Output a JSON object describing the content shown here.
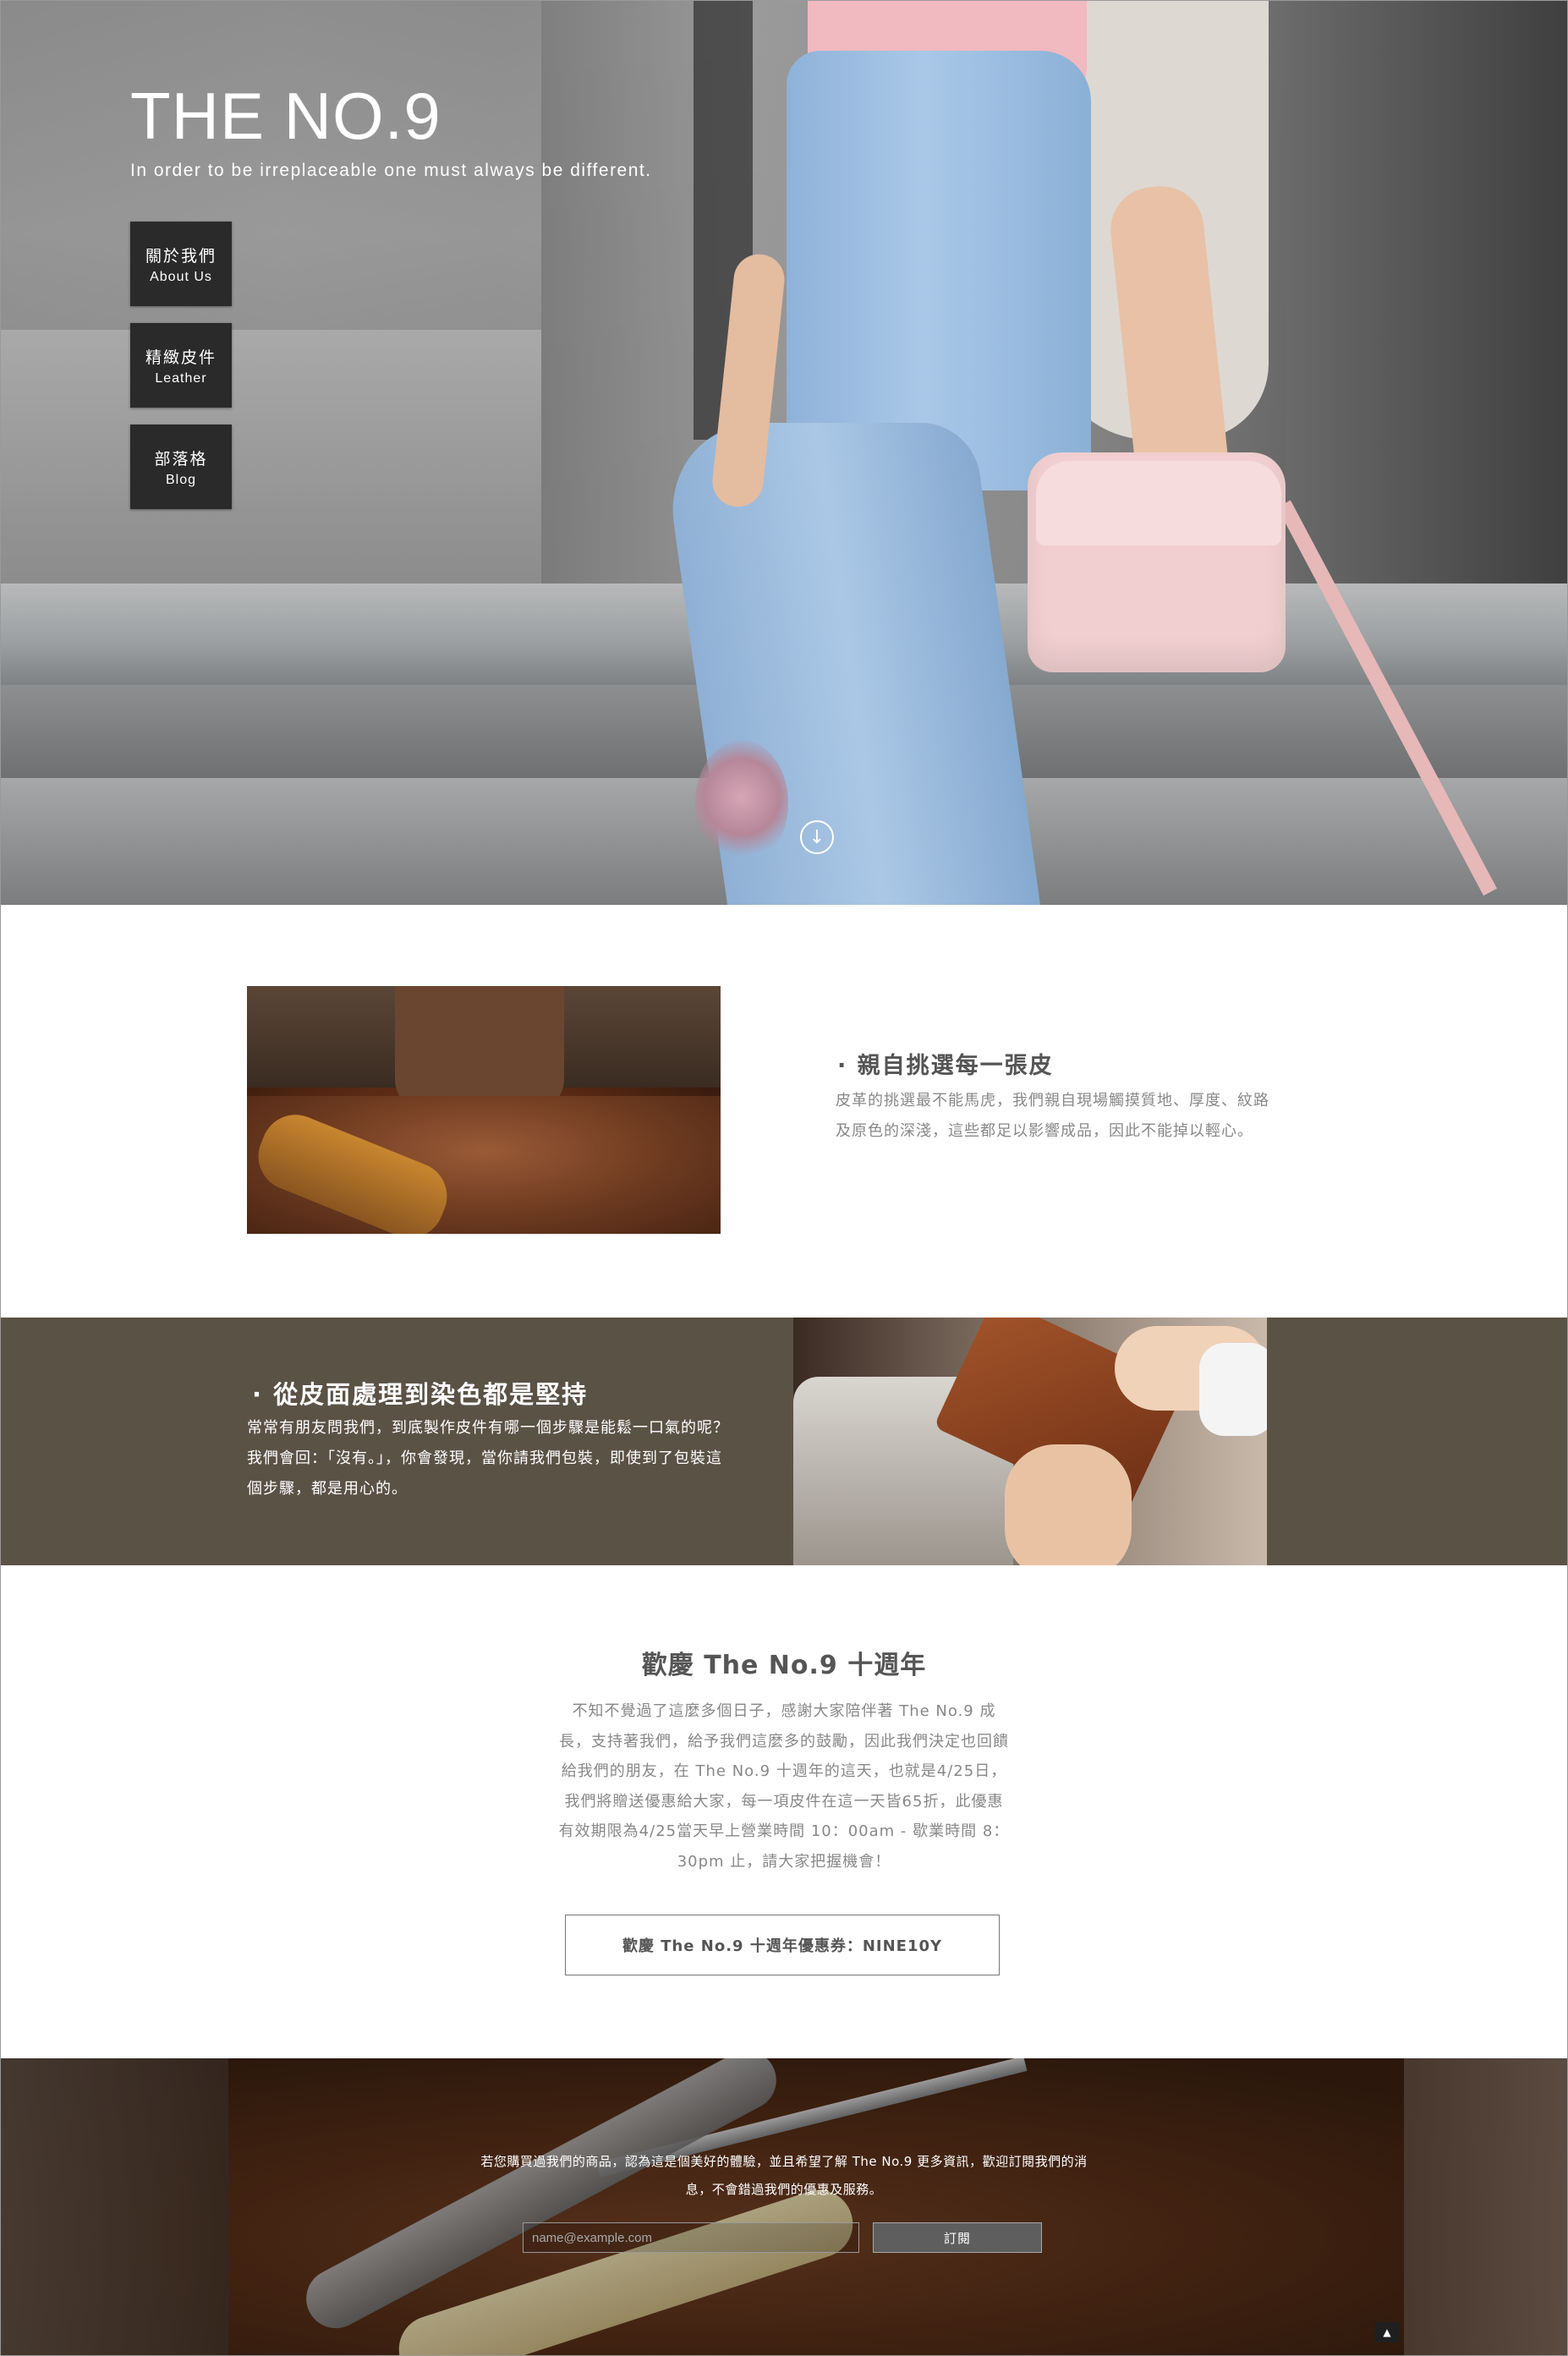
{
  "hero": {
    "title": "THE NO.9",
    "tagline": "In order to be irreplaceable one must always be different.",
    "nav": [
      {
        "zh": "關於我們",
        "en": "About Us"
      },
      {
        "zh": "精緻皮件",
        "en": "Leather"
      },
      {
        "zh": "部落格",
        "en": "Blog"
      }
    ],
    "scroll_icon": "arrow-down-circle-icon"
  },
  "feature1": {
    "title": "· 親自挑選每一張皮",
    "body": "皮革的挑選最不能馬虎，我們親自現場觸摸質地、厚度、紋路及原色的深淺，這些都足以影響成品，因此不能掉以輕心。"
  },
  "feature2": {
    "title": "· 從皮面處理到染色都是堅持",
    "body": "常常有朋友問我們，到底製作皮件有哪一個步驟是能鬆一口氣的呢？我們會回：「沒有。」，你會發現，當你請我們包裝，即使到了包裝這個步驟，都是用心的。"
  },
  "anniversary": {
    "title": "歡慶 The No.9 十週年",
    "body": "不知不覺過了這麼多個日子，感謝大家陪伴著 The No.9 成長，支持著我們，給予我們這麼多的鼓勵，因此我們決定也回饋給我們的朋友，在 The No.9 十週年的這天，也就是4/25日，我們將贈送優惠給大家，每一項皮件在這一天皆65折，此優惠有效期限為4/25當天早上營業時間 10：00am - 歇業時間 8：30pm 止，請大家把握機會！",
    "coupon": "歡慶 The No.9 十週年優惠券：NINE10Y"
  },
  "newsletter": {
    "text": "若您購買過我們的商品，認為這是個美好的體驗，並且希望了解 The No.9 更多資訊，歡迎訂閱我們的消息，不會錯過我們的優惠及服務。",
    "placeholder": "name@example.com",
    "button": "訂閱",
    "back_top_icon": "caret-up-icon"
  }
}
